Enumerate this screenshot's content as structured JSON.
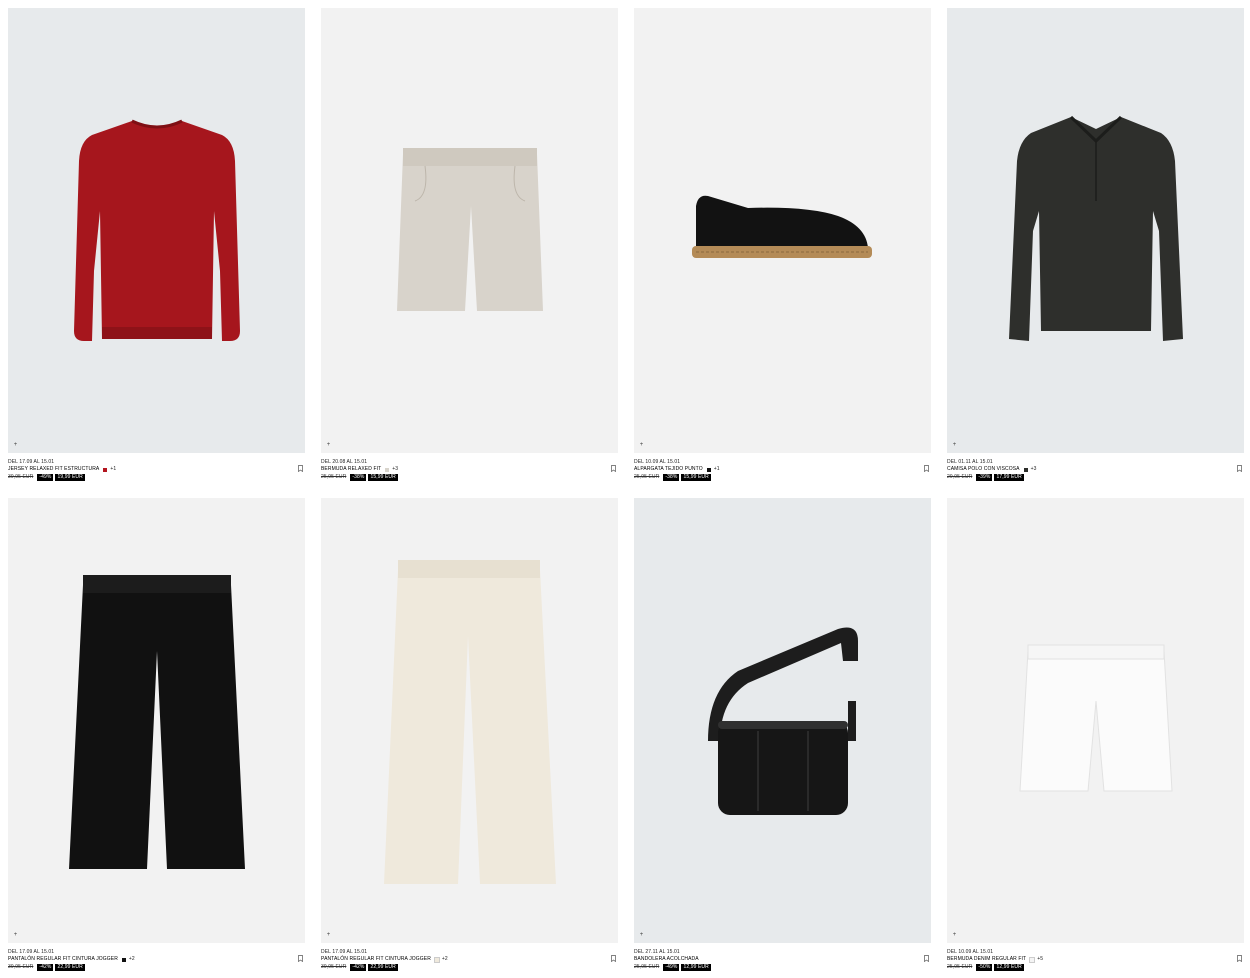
{
  "products": [
    {
      "dates": "DEL 17.09 AL 15.01",
      "name": "JERSEY RELAXED FIT ESTRUCTURA",
      "swatch": "#b3141e",
      "more": "+1",
      "old_price": "39,95 EUR",
      "discount": "-49%",
      "price": "19,99 EUR",
      "bg": "#e7eaec"
    },
    {
      "dates": "DEL 20.08 AL 15.01",
      "name": "BERMUDA RELAXED FIT",
      "swatch": "#d8d4cc",
      "more": "+3",
      "old_price": "25,95 EUR",
      "discount": "-38%",
      "price": "15,99 EUR",
      "bg": "#f2f2f2"
    },
    {
      "dates": "DEL 10.09 AL 15.01",
      "name": "ALPARGATA TEJIDO PUNTO",
      "swatch": "#111111",
      "more": "+1",
      "old_price": "25,95 EUR",
      "discount": "-38%",
      "price": "15,99 EUR",
      "bg": "#f2f2f2"
    },
    {
      "dates": "DEL 01.11 AL 15.01",
      "name": "CAMISA POLO CON VISCOSA",
      "swatch": "#2d2e2b",
      "more": "+3",
      "old_price": "29,95 EUR",
      "discount": "-39%",
      "price": "17,99 EUR",
      "bg": "#e7eaec"
    },
    {
      "dates": "DEL 17.09 AL 15.01",
      "name": "PANTALÓN REGULAR FIT CINTURA JOGGER",
      "swatch": "#111111",
      "more": "+2",
      "old_price": "39,95 EUR",
      "discount": "-42%",
      "price": "22,99 EUR",
      "bg": "#f2f2f2"
    },
    {
      "dates": "DEL 17.09 AL 15.01",
      "name": "PANTALÓN REGULAR FIT CINTURA JOGGER",
      "swatch": "#efe9dc",
      "more": "+2",
      "old_price": "39,95 EUR",
      "discount": "-42%",
      "price": "22,99 EUR",
      "bg": "#f2f2f2"
    },
    {
      "dates": "DEL 27.11 AL 15.01",
      "name": "BANDOLERA ACOLCHADA",
      "swatch": "",
      "more": "",
      "old_price": "25,95 EUR",
      "discount": "-49%",
      "price": "12,99 EUR",
      "bg": "#e7eaec"
    },
    {
      "dates": "DEL 10.09 AL 15.01",
      "name": "BERMUDA DENIM REGULAR FIT",
      "swatch": "#f4f4f4",
      "more": "+5",
      "old_price": "25,95 EUR",
      "discount": "-50%",
      "price": "12,99 EUR",
      "bg": "#f2f2f2"
    }
  ],
  "icons": {
    "add": "plus-icon",
    "save": "bookmark-icon"
  },
  "plus_glyph": "+"
}
